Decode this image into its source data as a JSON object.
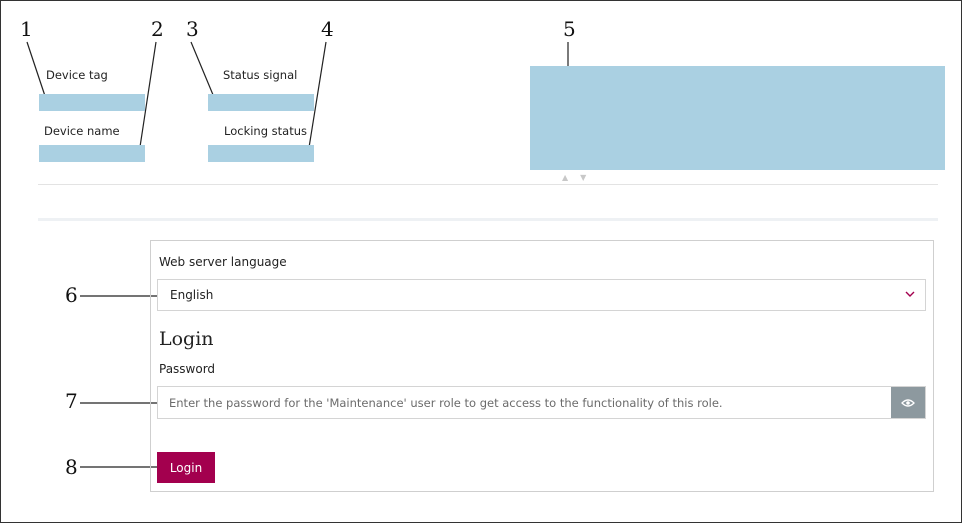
{
  "callouts": [
    "1",
    "2",
    "3",
    "4",
    "5",
    "6",
    "7",
    "8"
  ],
  "header": {
    "device_tag_label": "Device tag",
    "device_name_label": "Device name",
    "status_signal_label": "Status signal",
    "locking_status_label": "Locking status"
  },
  "form": {
    "language_label": "Web server language",
    "language_value": "English",
    "login_heading": "Login",
    "password_label": "Password",
    "password_placeholder": "Enter the password for the 'Maintenance' user role to get access to the functionality of this role.",
    "login_button": "Login"
  },
  "icons": {
    "dropdown": "chevron-down-icon",
    "reveal": "eye-icon",
    "nav": [
      "triangle-up-icon",
      "triangle-down-icon"
    ]
  },
  "colors": {
    "placeholder_bar": "#aad0e2",
    "accent": "#a3004e",
    "eye_button": "#8d999f"
  }
}
